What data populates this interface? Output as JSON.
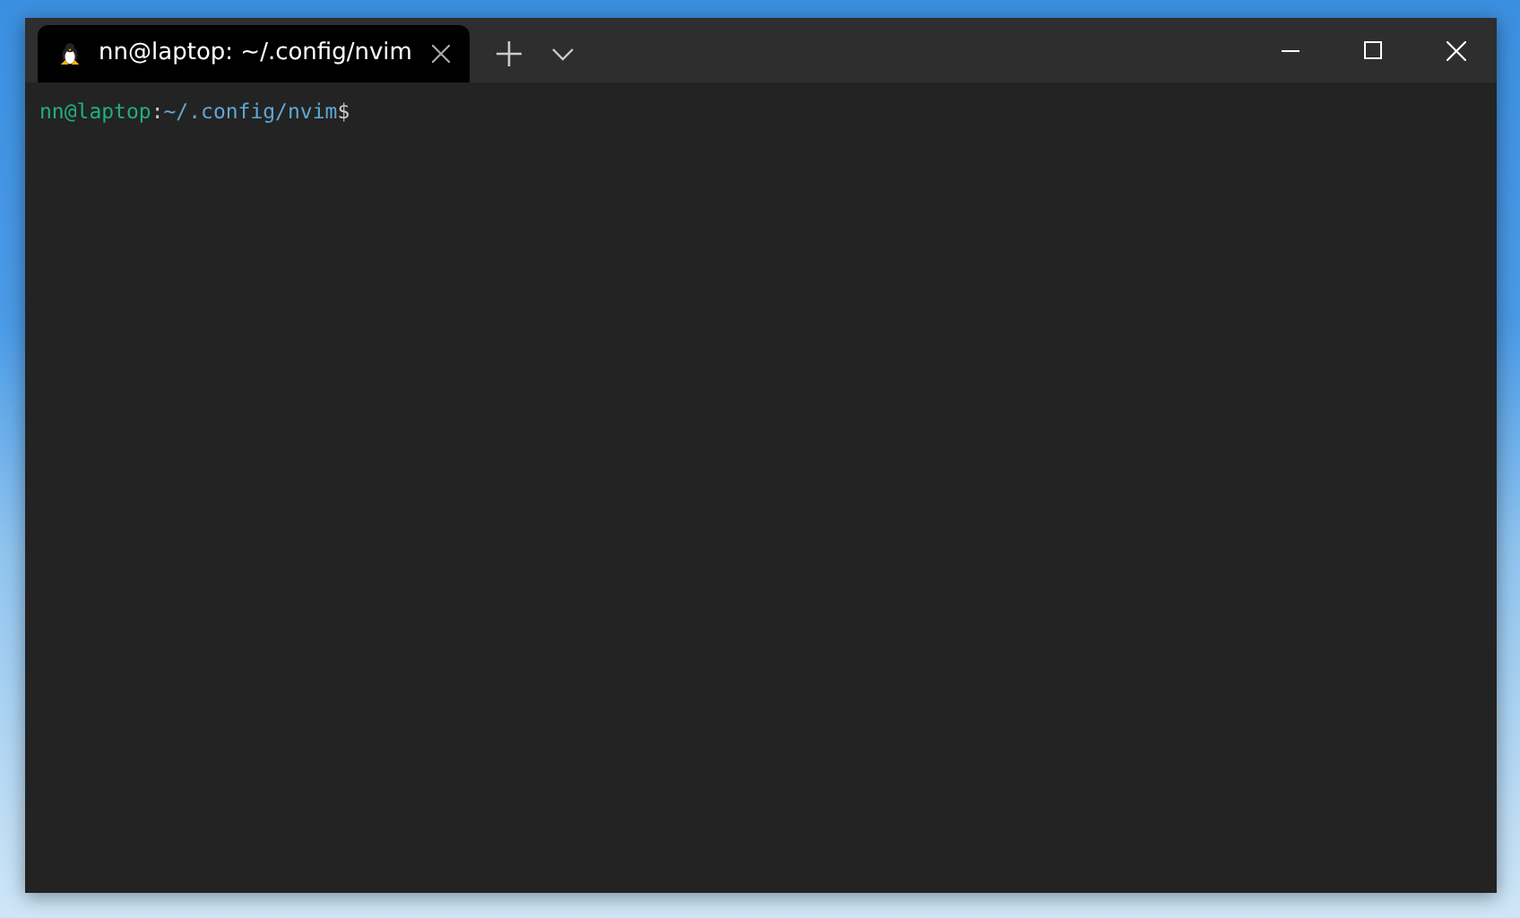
{
  "tabs": [
    {
      "title": "nn@laptop: ~/.config/nvim",
      "selected": true
    }
  ],
  "terminal": {
    "prompt": {
      "user_host": "nn@laptop",
      "separator": ":",
      "path": "~/.config/nvim",
      "symbol": "$"
    }
  }
}
